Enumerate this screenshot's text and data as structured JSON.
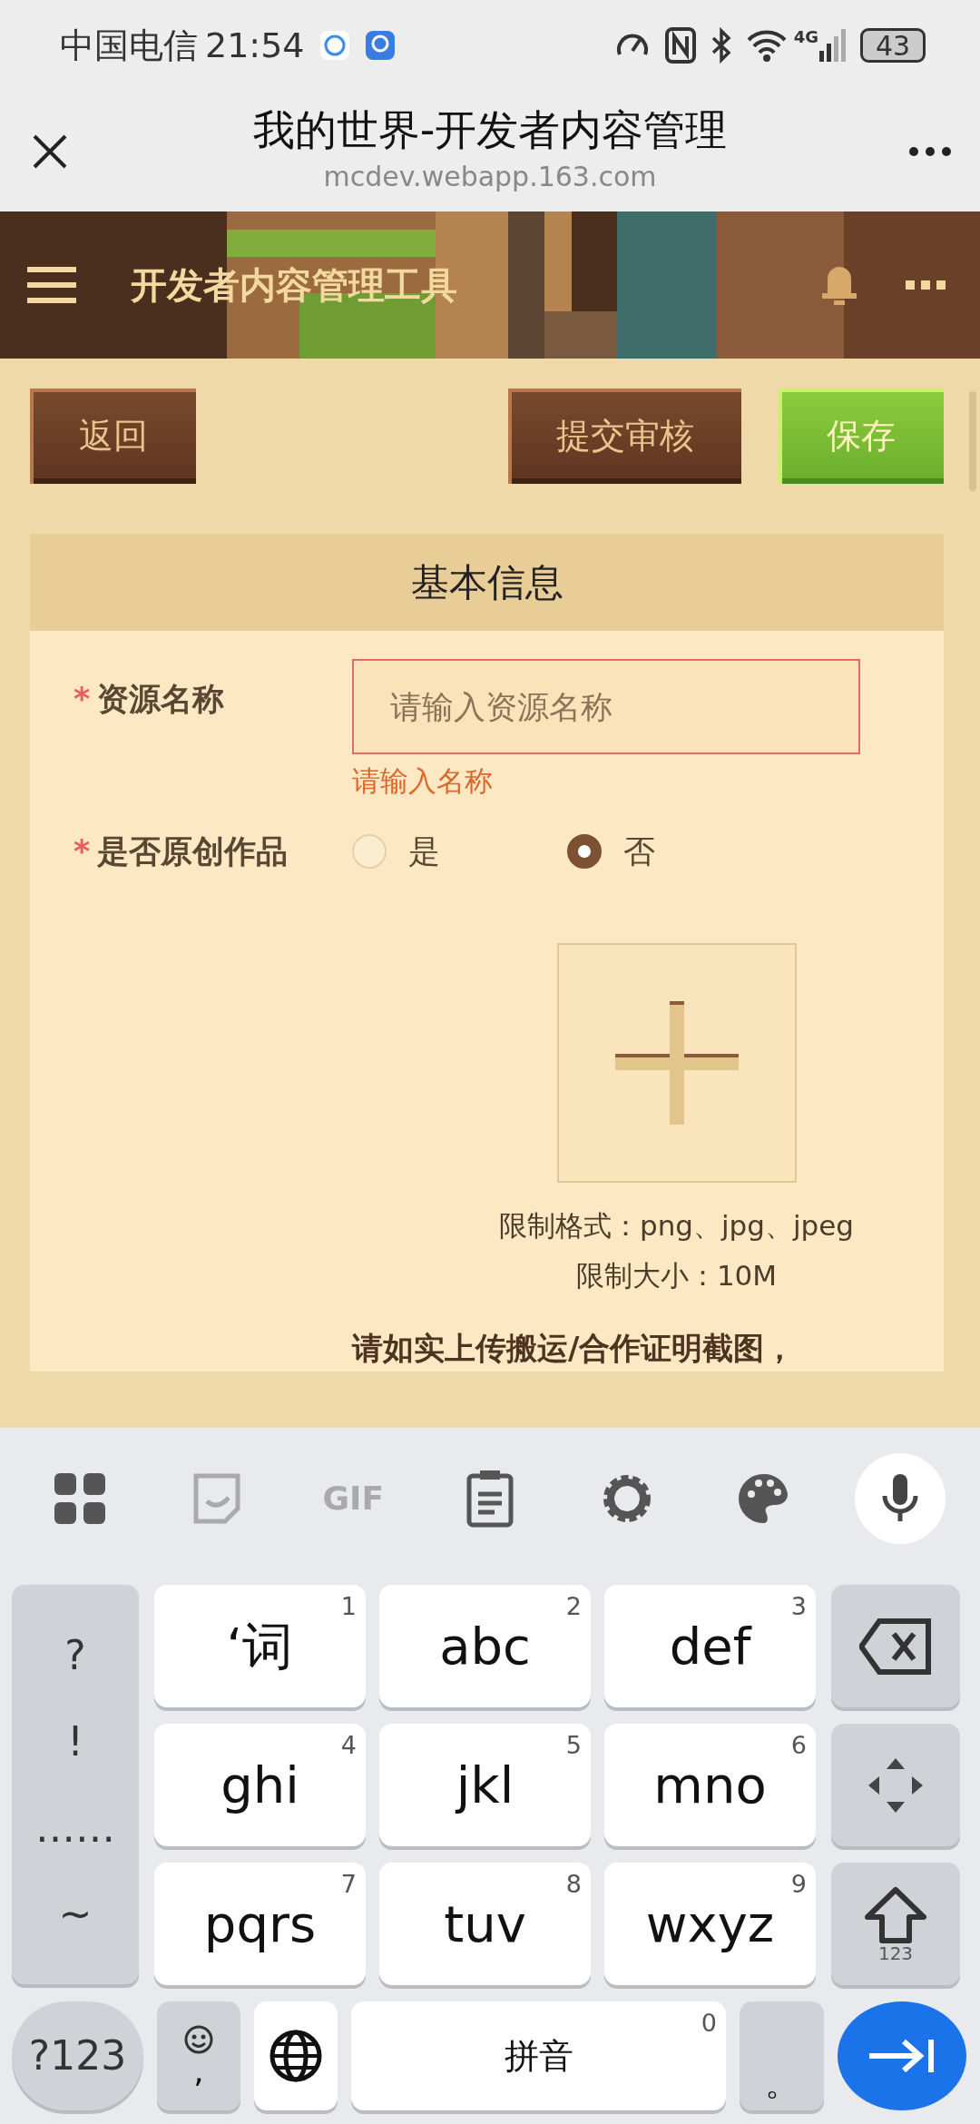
{
  "status_bar": {
    "carrier": "中国电信",
    "time": "21:54",
    "network": "4G",
    "battery": "43"
  },
  "browser": {
    "title": "我的世界-开发者内容管理",
    "url": "mcdev.webapp.163.com"
  },
  "app_header": {
    "title": "开发者内容管理工具"
  },
  "actions": [
    {
      "label": "返回",
      "kind": "default"
    },
    {
      "label": "提交审核",
      "kind": "default"
    },
    {
      "label": "保存",
      "kind": "primary"
    }
  ],
  "section": {
    "title": "基本信息"
  },
  "fields": [
    {
      "kind": "text",
      "required_mark": "*",
      "label": "资源名称",
      "placeholder": "请输入资源名称",
      "error": "请输入名称"
    },
    {
      "kind": "radio",
      "required_mark": "*",
      "label": "是否原创作品",
      "options": [
        {
          "label": "是",
          "selected": false
        },
        {
          "label": "否",
          "selected": true
        }
      ]
    }
  ],
  "upload": {
    "hints": [
      "限制格式：png、jpg、jpeg",
      "限制大小：10M"
    ],
    "notice": "请如实上传搬运/合作证明截图，"
  },
  "keyboard": {
    "toolbar": [
      {
        "kind": "apps"
      },
      {
        "kind": "sticker"
      },
      {
        "kind": "gif",
        "label": "GIF"
      },
      {
        "kind": "clipboard"
      },
      {
        "kind": "settings"
      },
      {
        "kind": "palette"
      },
      {
        "kind": "mic"
      }
    ],
    "symbols": [
      "?",
      "!",
      "……",
      "~"
    ],
    "keys": [
      {
        "label": "‘词",
        "digit": "1"
      },
      {
        "label": "abc",
        "digit": "2"
      },
      {
        "label": "def",
        "digit": "3"
      },
      {
        "label": "ghi",
        "digit": "4"
      },
      {
        "label": "jkl",
        "digit": "5"
      },
      {
        "label": "mno",
        "digit": "6"
      },
      {
        "label": "pqrs",
        "digit": "7"
      },
      {
        "label": "tuv",
        "digit": "8"
      },
      {
        "label": "wxyz",
        "digit": "9"
      }
    ],
    "shift_label": "123",
    "bottom": {
      "mode": "?123",
      "comma": ",",
      "space": "拼音",
      "space_digit": "0",
      "period": "。"
    }
  }
}
